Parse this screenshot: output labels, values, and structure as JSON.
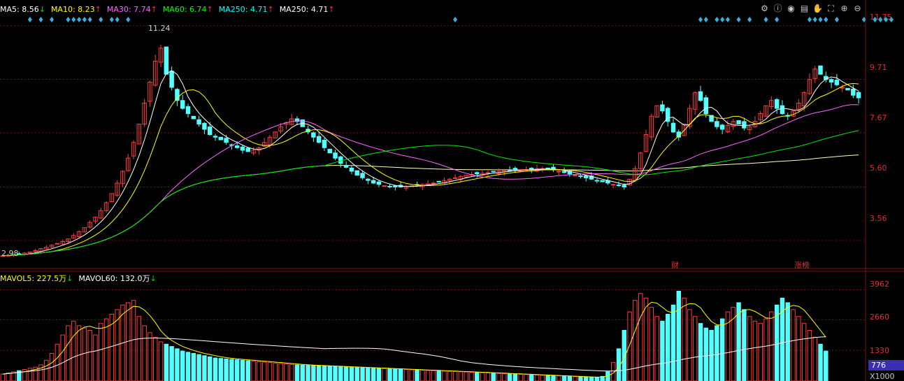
{
  "legend_price": [
    {
      "name": "MA5",
      "value": "8.56",
      "arrow": "↓",
      "color": "#ffffff",
      "arrow_color": "#00e000"
    },
    {
      "name": "MA10",
      "value": "8.23",
      "arrow": "↑",
      "color": "#ffff00",
      "arrow_color": "#ff3030"
    },
    {
      "name": "MA30",
      "value": "7.74",
      "arrow": "↑",
      "color": "#ff66ff",
      "arrow_color": "#ff3030"
    },
    {
      "name": "MA60",
      "value": "6.74",
      "arrow": "↑",
      "color": "#00ff00",
      "arrow_color": "#ff3030"
    },
    {
      "name": "MA250",
      "value": "4.71",
      "arrow": "↑",
      "color": "#00ffff",
      "arrow_color": "#ff3030"
    },
    {
      "name": "MA250",
      "value": "4.71",
      "arrow": "↑",
      "color": "#ffffff",
      "arrow_color": "#ff3030"
    }
  ],
  "legend_volume": [
    {
      "name": "MAVOL5",
      "value": "227.5万",
      "arrow": "↓",
      "color": "#ffff00",
      "arrow_color": "#00e000"
    },
    {
      "name": "MAVOL60",
      "value": "132.0万",
      "arrow": "↓",
      "color": "#ffffff",
      "arrow_color": "#00e000"
    }
  ],
  "toolbar": [
    "settings-icon",
    "info-icon",
    "eye-icon",
    "printer-icon",
    "hand-icon",
    "fullscreen-icon",
    "zoom-in-icon",
    "zoom-out-icon"
  ],
  "toolbar_glyphs": [
    "⚙",
    "ⓘ",
    "◉",
    "▤",
    "✋",
    "⛶",
    "⊕",
    "⊖"
  ],
  "price_axis": [
    "11.75",
    "9.71",
    "7.67",
    "5.60",
    "3.56"
  ],
  "volume_axis": [
    "3962",
    "2660",
    "1330"
  ],
  "current_volume": "776",
  "volume_unit": "X1000",
  "annotations": {
    "high": "11.24",
    "low": "2.98",
    "earnings": "财",
    "limit_list": "涨榜"
  },
  "colors": {
    "up": "#ff3b3b",
    "down": "#54ffff",
    "ma5": "#ffffff",
    "ma10": "#ffff00",
    "ma30": "#ff66ff",
    "ma60": "#00ee00",
    "ma250": "#ffffc0",
    "grid": "#7a1010"
  },
  "chart_data": {
    "type": "candlestick",
    "price_ylim": [
      2.6,
      12.2
    ],
    "volume_ylim": [
      0,
      4400
    ],
    "price_ticks": [
      11.75,
      9.71,
      7.67,
      5.6,
      3.56
    ],
    "volume_ticks": [
      3962,
      2660,
      1330
    ],
    "closes": [
      2.98,
      3.0,
      3.02,
      3.05,
      3.08,
      3.12,
      3.18,
      3.25,
      3.3,
      3.38,
      3.45,
      3.52,
      3.62,
      3.75,
      3.9,
      4.05,
      4.25,
      4.45,
      4.7,
      5.0,
      5.35,
      5.75,
      6.2,
      6.7,
      7.3,
      8.0,
      8.8,
      9.6,
      10.4,
      10.9,
      9.9,
      9.4,
      8.9,
      8.6,
      8.4,
      8.2,
      8.0,
      7.8,
      7.6,
      7.5,
      7.4,
      7.3,
      7.2,
      7.1,
      7.0,
      6.95,
      7.0,
      7.1,
      7.3,
      7.5,
      7.7,
      7.9,
      8.05,
      8.2,
      8.1,
      7.9,
      7.7,
      7.5,
      7.3,
      7.1,
      6.9,
      6.7,
      6.5,
      6.35,
      6.2,
      6.05,
      5.95,
      5.85,
      5.75,
      5.7,
      5.65,
      5.62,
      5.6,
      5.6,
      5.62,
      5.65,
      5.68,
      5.7,
      5.72,
      5.75,
      5.8,
      5.85,
      5.9,
      5.95,
      6.0,
      6.05,
      6.08,
      6.1,
      6.12,
      6.15,
      6.18,
      6.2,
      6.22,
      6.24,
      6.25,
      6.26,
      6.27,
      6.28,
      6.3,
      6.3,
      6.28,
      6.25,
      6.2,
      6.15,
      6.1,
      6.05,
      6.0,
      5.95,
      5.9,
      5.85,
      5.8,
      5.75,
      5.7,
      5.65,
      5.6,
      5.9,
      6.3,
      6.9,
      7.6,
      8.3,
      8.7,
      8.5,
      8.1,
      7.7,
      7.5,
      8.0,
      8.6,
      9.2,
      8.9,
      8.4,
      8.1,
      7.9,
      7.8,
      7.95,
      8.1,
      8.0,
      7.85,
      7.9,
      8.1,
      8.4,
      8.7,
      8.9,
      8.6,
      8.4,
      8.3,
      8.5,
      8.8,
      9.2,
      9.7,
      10.1,
      9.9,
      9.7,
      9.6,
      9.5,
      9.4,
      9.3,
      9.1,
      9.0
    ],
    "volume": [
      300,
      350,
      400,
      450,
      500,
      550,
      600,
      700,
      900,
      1200,
      1600,
      2000,
      2400,
      2600,
      2400,
      2300,
      2200,
      2000,
      2500,
      2700,
      2900,
      3100,
      3300,
      3400,
      3500,
      2800,
      2400,
      2100,
      1900,
      1700,
      1600,
      1500,
      1400,
      1300,
      1250,
      1200,
      1150,
      1100,
      1050,
      1000,
      980,
      960,
      940,
      920,
      900,
      880,
      860,
      840,
      820,
      800,
      780,
      760,
      740,
      720,
      700,
      690,
      680,
      670,
      660,
      650,
      640,
      630,
      620,
      610,
      600,
      590,
      580,
      570,
      560,
      550,
      540,
      530,
      520,
      510,
      500,
      490,
      480,
      470,
      460,
      450,
      440,
      430,
      420,
      410,
      400,
      390,
      380,
      370,
      360,
      350,
      340,
      330,
      320,
      310,
      300,
      290,
      280,
      270,
      260,
      250,
      240,
      230,
      220,
      210,
      200,
      190,
      180,
      170,
      160,
      150,
      200,
      400,
      800,
      1400,
      2200,
      3000,
      3500,
      3800,
      3600,
      3200,
      2800,
      2600,
      2900,
      3300,
      3900,
      3600,
      3100,
      2800,
      2500,
      2300,
      2200,
      2400,
      2700,
      3000,
      3200,
      3400,
      3100,
      2800,
      2600,
      2500,
      2700,
      3000,
      3300,
      3600,
      3400,
      3100,
      2800,
      2500,
      2200,
      1900,
      1600,
      1300
    ]
  }
}
